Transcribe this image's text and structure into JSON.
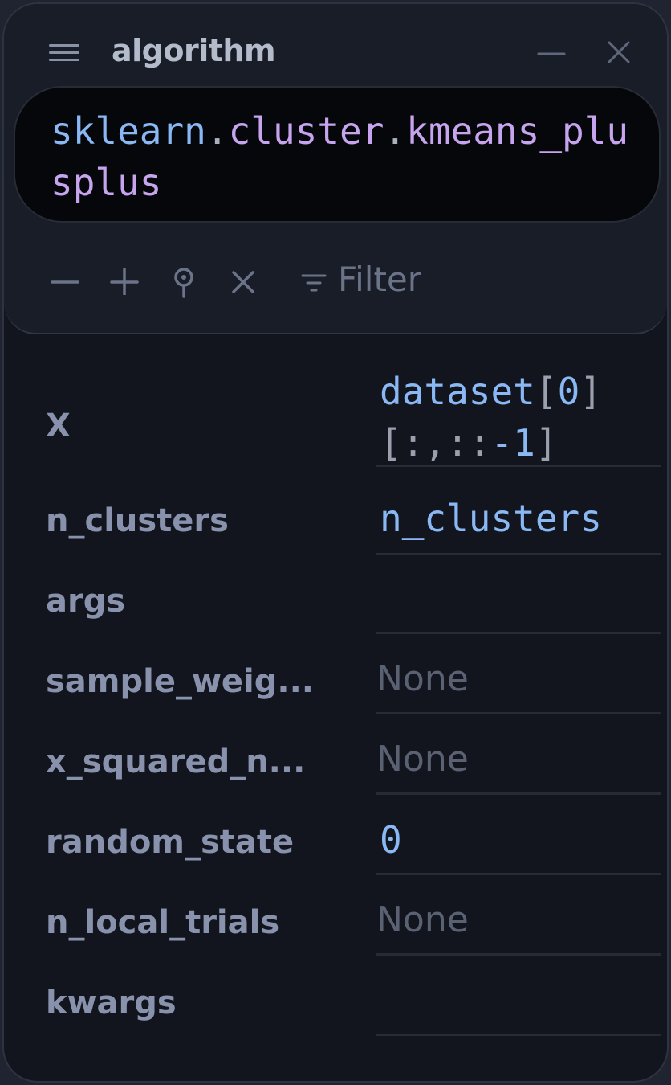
{
  "panel": {
    "title": "algorithm",
    "title_icon": "hamburger-menu-icon",
    "window_controls": [
      "minimize-icon",
      "close-icon"
    ]
  },
  "code": {
    "package": "sklearn",
    "module": "cluster",
    "function": "kmeans_plusplus",
    "full": "sklearn.cluster.kmeans_plusplus"
  },
  "toolbar": {
    "icons": [
      "minus-icon",
      "plus-icon",
      "pin-icon",
      "close-icon",
      "filter-icon"
    ],
    "filter_placeholder": "Filter"
  },
  "params": [
    {
      "label": "X",
      "value": "dataset[0][:,::-1]",
      "value_parts": [
        "dataset",
        "[",
        "0",
        "]",
        "[:,::",
        "-1",
        "]"
      ],
      "kind": "expr"
    },
    {
      "label": "n_clusters",
      "value": "n_clusters",
      "kind": "expr"
    },
    {
      "label": "args",
      "value": "",
      "kind": "empty"
    },
    {
      "label": "sample_weig...",
      "value": "None",
      "kind": "placeholder"
    },
    {
      "label": "x_squared_n...",
      "value": "None",
      "kind": "placeholder"
    },
    {
      "label": "random_state",
      "value": "0",
      "kind": "expr"
    },
    {
      "label": "n_local_trials",
      "value": "None",
      "kind": "placeholder"
    },
    {
      "label": "kwargs",
      "value": "",
      "kind": "empty"
    }
  ],
  "colors": {
    "panel_bg": "#12151d",
    "header_bg": "#191d28",
    "code_bg": "#06070a",
    "label": "#8992ad",
    "value_blue": "#8ab8f4",
    "value_purple": "#c7a4ee",
    "placeholder": "#5a6172"
  }
}
